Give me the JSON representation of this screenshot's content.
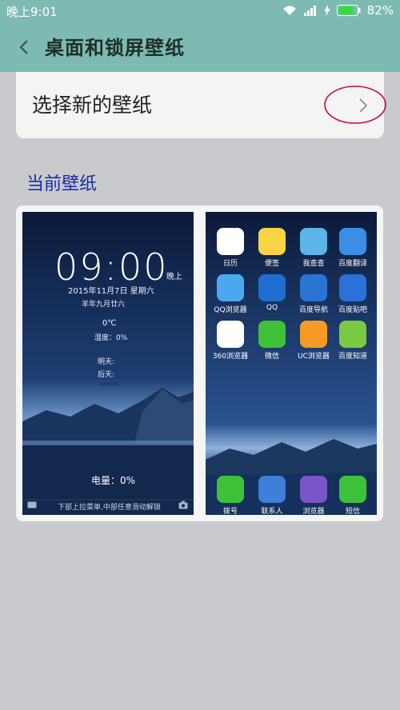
{
  "status_bar": {
    "time": "晚上9:01",
    "battery_percent": "82%",
    "battery_level": 0.82
  },
  "app_bar": {
    "title": "桌面和锁屏壁纸",
    "back_icon": "back-arrow-icon"
  },
  "choose_wallpaper": {
    "label": "选择新的壁纸"
  },
  "current_wallpaper": {
    "section_title": "当前壁纸"
  },
  "lock_screen": {
    "clock": "09:00",
    "ampm": "晚上",
    "date": "2015年11月7日  星期六",
    "lunar": "羊年九月廿六",
    "temperature": "0℃",
    "humidity": "湿度：0%",
    "tomorrow": "明天:",
    "after_tomorrow": "后天:",
    "battery": "电量：0%",
    "hint": "下部上拉菜单,中部任意滑动解锁"
  },
  "home_screen": {
    "apps": [
      {
        "label": "日历",
        "icon": "calendar-icon",
        "color": "#ffffff"
      },
      {
        "label": "便签",
        "icon": "notes-icon",
        "color": "#f7d544"
      },
      {
        "label": "我查查",
        "icon": "barcode-icon",
        "color": "#5cb5e8"
      },
      {
        "label": "百度翻译",
        "icon": "translate-icon",
        "color": "#3a8ee6"
      },
      {
        "label": "QQ浏览器",
        "icon": "qq-browser-icon",
        "color": "#4aa7f2"
      },
      {
        "label": "QQ",
        "icon": "qq-penguin-icon",
        "color": "#1e6fcf"
      },
      {
        "label": "百度导航",
        "icon": "navigation-icon",
        "color": "#2a74d6"
      },
      {
        "label": "百度贴吧",
        "icon": "tieba-icon",
        "color": "#2a72d8"
      },
      {
        "label": "360浏览器",
        "icon": "360-browser-icon",
        "color": "#ffffff"
      },
      {
        "label": "微信",
        "icon": "wechat-icon",
        "color": "#3fc238"
      },
      {
        "label": "UC浏览器",
        "icon": "uc-browser-icon",
        "color": "#f59a23"
      },
      {
        "label": "百度知道",
        "icon": "baidu-zhidao-icon",
        "color": "#7ac943"
      }
    ],
    "dock": [
      {
        "label": "拨号",
        "icon": "phone-icon",
        "color": "#3ec23a"
      },
      {
        "label": "联系人",
        "icon": "contacts-icon",
        "color": "#3d7fd9"
      },
      {
        "label": "浏览器",
        "icon": "browser-icon",
        "color": "#7a55c9"
      },
      {
        "label": "短信",
        "icon": "sms-icon",
        "color": "#3ec23a"
      }
    ]
  },
  "colors": {
    "accent": "#7dbab2",
    "section_title": "#1b2aa8",
    "annotation": "#c8102e"
  }
}
